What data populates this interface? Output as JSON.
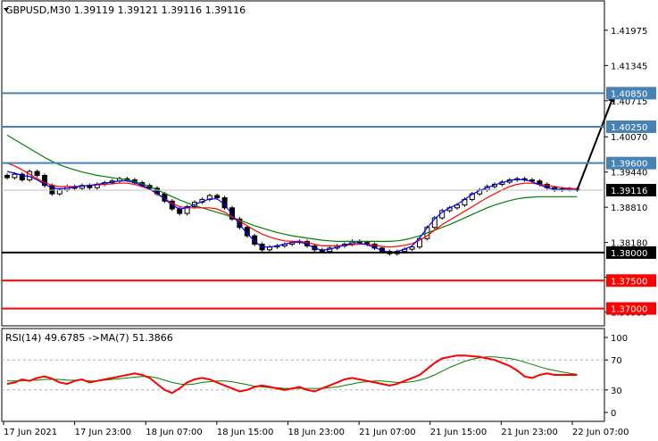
{
  "header": {
    "symbol_line": "GBPUSD,M30  1.39119 1.39121 1.39116 1.39116",
    "rsi_line": "RSI(14) 49.6785  ->MA(7) 51.3866"
  },
  "colors": {
    "candle": "#000000",
    "ma_fast": "#0000ff",
    "ma_mid": "#ff0000",
    "ma_slow": "#008000",
    "resistance": "#4682b4",
    "support_key": "#000000",
    "support": "#ff0000",
    "rsi": "#ff0000",
    "rsi_ma": "#008000"
  },
  "chart_data": [
    {
      "type": "candlestick",
      "symbol": "GBPUSD",
      "timeframe": "M30",
      "ylim": [
        1.3669,
        1.425
      ],
      "y_ticks": [
        "1.41975",
        "1.41345",
        "1.40715",
        "1.40070",
        "1.39440",
        "1.38810",
        "1.38180",
        "1.37560",
        "1.36935"
      ],
      "x_ticks": [
        "17 Jun 2021",
        "17 Jun 23:00",
        "18 Jun 07:00",
        "18 Jun 15:00",
        "18 Jun 23:00",
        "21 Jun 07:00",
        "21 Jun 15:00",
        "21 Jun 23:00",
        "22 Jun 07:00"
      ],
      "current_price": {
        "value": 1.39116,
        "label": "1.39116"
      },
      "levels": [
        {
          "value": 1.4085,
          "label": "1.40850",
          "role": "resistance"
        },
        {
          "value": 1.4025,
          "label": "1.40250",
          "role": "resistance"
        },
        {
          "value": 1.396,
          "label": "1.39600",
          "role": "resistance"
        },
        {
          "value": 1.38,
          "label": "1.38000",
          "role": "support_key"
        },
        {
          "value": 1.375,
          "label": "1.37500",
          "role": "support"
        },
        {
          "value": 1.37,
          "label": "1.37000",
          "role": "support"
        }
      ],
      "candles_close": [
        1.3934,
        1.394,
        1.393,
        1.3945,
        1.3938,
        1.392,
        1.3905,
        1.3912,
        1.3918,
        1.3915,
        1.392,
        1.3916,
        1.3922,
        1.3925,
        1.3928,
        1.3932,
        1.393,
        1.3925,
        1.392,
        1.3915,
        1.3905,
        1.3892,
        1.3878,
        1.387,
        1.3882,
        1.389,
        1.3895,
        1.3902,
        1.3898,
        1.388,
        1.386,
        1.3845,
        1.383,
        1.3815,
        1.3805,
        1.381,
        1.3812,
        1.3815,
        1.3818,
        1.382,
        1.3812,
        1.3805,
        1.3802,
        1.3808,
        1.3812,
        1.3815,
        1.382,
        1.3818,
        1.3815,
        1.3808,
        1.3802,
        1.3798,
        1.3802,
        1.3806,
        1.381,
        1.3825,
        1.3845,
        1.3862,
        1.3875,
        1.388,
        1.3885,
        1.3895,
        1.3905,
        1.3912,
        1.3918,
        1.3922,
        1.3926,
        1.393,
        1.3932,
        1.393,
        1.3928,
        1.3922,
        1.3916,
        1.3912,
        1.3914,
        1.3913,
        1.3912
      ],
      "ma_fast": [
        1.3945,
        1.3942,
        1.3938,
        1.3936,
        1.393,
        1.3922,
        1.3916,
        1.3914,
        1.3915,
        1.3917,
        1.3919,
        1.392,
        1.3922,
        1.3924,
        1.3926,
        1.3928,
        1.3928,
        1.3925,
        1.392,
        1.3914,
        1.3906,
        1.3896,
        1.3885,
        1.3878,
        1.388,
        1.3886,
        1.3891,
        1.3896,
        1.3896,
        1.3886,
        1.3868,
        1.385,
        1.3834,
        1.382,
        1.381,
        1.381,
        1.3812,
        1.3815,
        1.3818,
        1.3819,
        1.3815,
        1.3808,
        1.3804,
        1.3806,
        1.381,
        1.3813,
        1.3818,
        1.3817,
        1.3814,
        1.3809,
        1.3804,
        1.38,
        1.3802,
        1.3806,
        1.3812,
        1.3826,
        1.3844,
        1.386,
        1.3872,
        1.388,
        1.3886,
        1.3895,
        1.3904,
        1.3911,
        1.3916,
        1.3921,
        1.3925,
        1.3929,
        1.3931,
        1.393,
        1.3927,
        1.3921,
        1.3916,
        1.3913,
        1.3913,
        1.3913,
        1.3912
      ],
      "ma_mid": [
        1.396,
        1.3955,
        1.3948,
        1.394,
        1.3932,
        1.3925,
        1.392,
        1.3918,
        1.3918,
        1.3918,
        1.3919,
        1.392,
        1.3921,
        1.3922,
        1.3923,
        1.3924,
        1.3924,
        1.3922,
        1.3918,
        1.3913,
        1.3905,
        1.3896,
        1.3888,
        1.3882,
        1.388,
        1.388,
        1.388,
        1.388,
        1.3878,
        1.3872,
        1.3864,
        1.3856,
        1.3848,
        1.384,
        1.3833,
        1.3828,
        1.3824,
        1.3821,
        1.382,
        1.382,
        1.3818,
        1.3815,
        1.3812,
        1.3812,
        1.3812,
        1.3813,
        1.3814,
        1.3815,
        1.3815,
        1.3813,
        1.3811,
        1.381,
        1.3811,
        1.3813,
        1.3816,
        1.3822,
        1.383,
        1.384,
        1.385,
        1.3858,
        1.3866,
        1.3874,
        1.3882,
        1.389,
        1.3898,
        1.3905,
        1.3912,
        1.3918,
        1.3922,
        1.3924,
        1.3924,
        1.3922,
        1.392,
        1.3918,
        1.3916,
        1.3915,
        1.3914
      ],
      "ma_slow": [
        1.401,
        1.4002,
        1.3994,
        1.3986,
        1.3978,
        1.397,
        1.3963,
        1.3957,
        1.3952,
        1.3948,
        1.3944,
        1.3941,
        1.3938,
        1.3936,
        1.3934,
        1.3932,
        1.393,
        1.3927,
        1.3923,
        1.3918,
        1.3912,
        1.3906,
        1.39,
        1.3894,
        1.3889,
        1.3884,
        1.388,
        1.3876,
        1.3872,
        1.3868,
        1.3863,
        1.3858,
        1.3853,
        1.3848,
        1.3844,
        1.384,
        1.3836,
        1.3833,
        1.383,
        1.3828,
        1.3826,
        1.3824,
        1.3822,
        1.3821,
        1.382,
        1.382,
        1.382,
        1.382,
        1.382,
        1.382,
        1.382,
        1.382,
        1.3821,
        1.3823,
        1.3826,
        1.383,
        1.3835,
        1.384,
        1.3845,
        1.385,
        1.3856,
        1.3862,
        1.3868,
        1.3874,
        1.388,
        1.3885,
        1.3889,
        1.3893,
        1.3896,
        1.3898,
        1.3899,
        1.39,
        1.39,
        1.39,
        1.39,
        1.39,
        1.39
      ],
      "projection": [
        {
          "index": 76,
          "value": 1.39116
        },
        {
          "index": 81,
          "value": 1.4085
        }
      ]
    },
    {
      "type": "line",
      "name": "RSI(14)",
      "value_label": "49.6785",
      "ma_label": "MA(7) 51.3866",
      "ylim": [
        0,
        100
      ],
      "y_ticks": [
        100,
        70,
        30,
        0
      ],
      "guide_lines": [
        70,
        30
      ],
      "rsi": [
        38,
        40,
        44,
        42,
        46,
        48,
        45,
        40,
        38,
        42,
        44,
        40,
        42,
        44,
        46,
        48,
        50,
        52,
        50,
        46,
        38,
        30,
        26,
        32,
        40,
        44,
        46,
        44,
        40,
        36,
        32,
        28,
        30,
        34,
        36,
        34,
        32,
        30,
        32,
        34,
        30,
        28,
        32,
        36,
        40,
        44,
        46,
        44,
        42,
        40,
        38,
        36,
        38,
        42,
        46,
        50,
        58,
        66,
        72,
        74,
        76,
        76,
        75,
        74,
        72,
        70,
        66,
        62,
        56,
        48,
        46,
        50,
        52,
        50,
        50,
        50,
        50
      ],
      "rsi_ma": [
        42,
        42,
        42,
        43,
        43,
        44,
        44,
        44,
        43,
        43,
        43,
        42,
        42,
        43,
        44,
        45,
        46,
        47,
        48,
        48,
        46,
        43,
        40,
        38,
        37,
        38,
        40,
        41,
        42,
        42,
        41,
        39,
        37,
        35,
        34,
        33,
        33,
        32,
        32,
        32,
        32,
        32,
        32,
        33,
        34,
        36,
        38,
        40,
        41,
        42,
        42,
        41,
        40,
        40,
        41,
        43,
        46,
        50,
        55,
        60,
        64,
        68,
        71,
        73,
        74,
        74,
        73,
        72,
        70,
        67,
        64,
        61,
        58,
        56,
        54,
        52,
        51
      ]
    }
  ]
}
